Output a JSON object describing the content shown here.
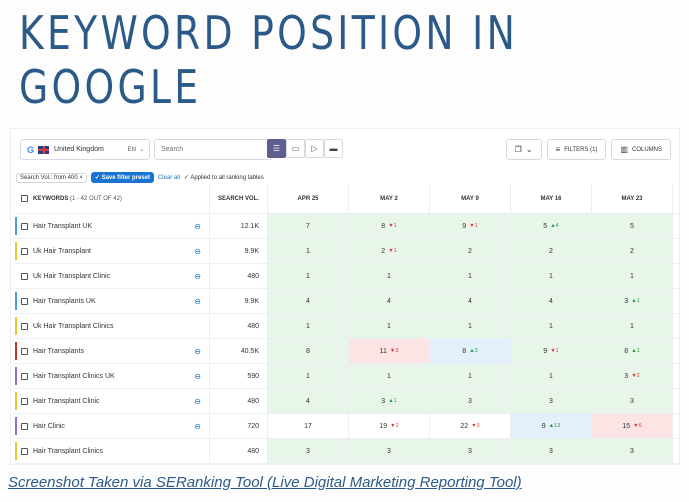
{
  "page": {
    "title": "KEYWORD POSITION IN GOOGLE",
    "caption": "Screenshot Taken via SERanking Tool (Live Digital Marketing Reporting Tool)"
  },
  "toolbar": {
    "region": "United Kingdom",
    "lang": "EN",
    "search_placeholder": "Search",
    "filters_label": "FILTERS (1)",
    "columns_label": "COLUMNS"
  },
  "filterline": {
    "chip": "Search Vol.: from 400",
    "save_label": "Save filter preset",
    "clear_label": "Clear all",
    "applied_label": "Applied to all ranking tables"
  },
  "table": {
    "headers": {
      "keywords": "KEYWORDS",
      "keywords_count": "(1 - 42 OUT OF 42)",
      "volume": "SEARCH VOL.",
      "dates": [
        "APR 25",
        "MAY 2",
        "MAY 9",
        "MAY 16",
        "MAY 23"
      ]
    },
    "rows": [
      {
        "keyword": "Hair Transplant UK",
        "volume": "12.1K",
        "bar": "#4a9ee8",
        "link": true,
        "cells": [
          {
            "v": "7",
            "c": "green"
          },
          {
            "v": "8",
            "d": "1",
            "dir": "down",
            "c": "green"
          },
          {
            "v": "9",
            "d": "1",
            "dir": "down",
            "c": "green"
          },
          {
            "v": "5",
            "d": "4",
            "dir": "up",
            "c": "green"
          },
          {
            "v": "5",
            "c": "green"
          }
        ]
      },
      {
        "keyword": "Uk Hair Transplant",
        "volume": "9.9K",
        "bar": "#e8c63a",
        "link": true,
        "cells": [
          {
            "v": "1",
            "c": "green"
          },
          {
            "v": "2",
            "d": "1",
            "dir": "down",
            "c": "green"
          },
          {
            "v": "2",
            "c": "green"
          },
          {
            "v": "2",
            "c": "green"
          },
          {
            "v": "2",
            "c": "green"
          }
        ]
      },
      {
        "keyword": "Uk Hair Transplant Clinic",
        "volume": "480",
        "bar": "",
        "link": true,
        "cells": [
          {
            "v": "1",
            "c": "green"
          },
          {
            "v": "1",
            "c": "green"
          },
          {
            "v": "1",
            "c": "green"
          },
          {
            "v": "1",
            "c": "green"
          },
          {
            "v": "1",
            "c": "green"
          }
        ]
      },
      {
        "keyword": "Hair Transplants UK",
        "volume": "9.9K",
        "bar": "#4a9ee8",
        "link": true,
        "cells": [
          {
            "v": "4",
            "c": "green"
          },
          {
            "v": "4",
            "c": "green"
          },
          {
            "v": "4",
            "c": "green"
          },
          {
            "v": "4",
            "c": "green"
          },
          {
            "v": "3",
            "d": "1",
            "dir": "up",
            "c": "green"
          }
        ]
      },
      {
        "keyword": "Uk Hair Transplant Clinics",
        "volume": "480",
        "bar": "#e8c63a",
        "link": false,
        "cells": [
          {
            "v": "1",
            "c": "green"
          },
          {
            "v": "1",
            "c": "green"
          },
          {
            "v": "1",
            "c": "green"
          },
          {
            "v": "1",
            "c": "green"
          },
          {
            "v": "1",
            "c": "green"
          }
        ]
      },
      {
        "keyword": "Hair Transplants",
        "volume": "40.5K",
        "bar": "#c0392b",
        "link": true,
        "cells": [
          {
            "v": "8",
            "c": "green"
          },
          {
            "v": "11",
            "d": "3",
            "dir": "down",
            "c": "red"
          },
          {
            "v": "8",
            "d": "3",
            "dir": "up",
            "c": "blue"
          },
          {
            "v": "9",
            "d": "1",
            "dir": "down",
            "c": "green"
          },
          {
            "v": "8",
            "d": "1",
            "dir": "up",
            "c": "green"
          }
        ]
      },
      {
        "keyword": "Hair Transplant Clinics UK",
        "volume": "590",
        "bar": "#8e6fd1",
        "link": true,
        "cells": [
          {
            "v": "1",
            "c": "green"
          },
          {
            "v": "1",
            "c": "green"
          },
          {
            "v": "1",
            "c": "green"
          },
          {
            "v": "1",
            "c": "green"
          },
          {
            "v": "3",
            "d": "2",
            "dir": "down",
            "c": "green"
          }
        ]
      },
      {
        "keyword": "Hair Transplant Clinic",
        "volume": "480",
        "bar": "#e8c63a",
        "link": true,
        "cells": [
          {
            "v": "4",
            "c": "green"
          },
          {
            "v": "3",
            "d": "1",
            "dir": "up",
            "c": "green"
          },
          {
            "v": "3",
            "c": "green"
          },
          {
            "v": "3",
            "c": "green"
          },
          {
            "v": "3",
            "c": "green"
          }
        ]
      },
      {
        "keyword": "Hair Clinic",
        "volume": "720",
        "bar": "#8e6fd1",
        "link": true,
        "cells": [
          {
            "v": "17",
            "c": "none"
          },
          {
            "v": "19",
            "d": "2",
            "dir": "down",
            "c": "none"
          },
          {
            "v": "22",
            "d": "3",
            "dir": "down",
            "c": "none"
          },
          {
            "v": "9",
            "d": "13",
            "dir": "up",
            "c": "blue"
          },
          {
            "v": "15",
            "d": "6",
            "dir": "down",
            "c": "red"
          }
        ]
      },
      {
        "keyword": "Hair Transplant Clinics",
        "volume": "480",
        "bar": "#e8c63a",
        "link": false,
        "cells": [
          {
            "v": "3",
            "c": "green"
          },
          {
            "v": "3",
            "c": "green"
          },
          {
            "v": "3",
            "c": "green"
          },
          {
            "v": "3",
            "c": "green"
          },
          {
            "v": "3",
            "c": "green"
          }
        ]
      }
    ]
  }
}
